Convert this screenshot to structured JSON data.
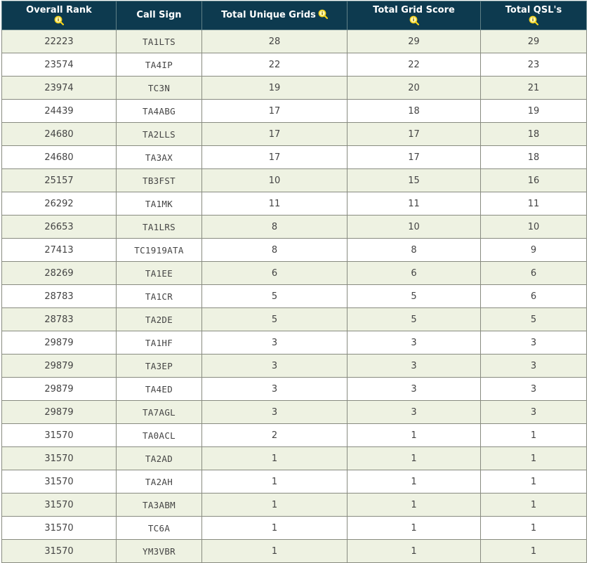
{
  "headers": [
    {
      "label": "Overall Rank",
      "icon": "magnifier-info-icon",
      "icon_below": true
    },
    {
      "label": "Call Sign",
      "icon": null,
      "icon_below": false
    },
    {
      "label": "Total Unique Grids",
      "icon": "magnifier-info-icon",
      "icon_below": false
    },
    {
      "label": "Total Grid Score",
      "icon": "magnifier-info-icon",
      "icon_below": true
    },
    {
      "label": "Total QSL's",
      "icon": "magnifier-info-icon",
      "icon_below": true
    }
  ],
  "rows": [
    [
      "22223",
      "TA1LTS",
      "28",
      "29",
      "29"
    ],
    [
      "23574",
      "TA4IP",
      "22",
      "22",
      "23"
    ],
    [
      "23974",
      "TC3N",
      "19",
      "20",
      "21"
    ],
    [
      "24439",
      "TA4ABG",
      "17",
      "18",
      "19"
    ],
    [
      "24680",
      "TA2LLS",
      "17",
      "17",
      "18"
    ],
    [
      "24680",
      "TA3AX",
      "17",
      "17",
      "18"
    ],
    [
      "25157",
      "TB3FST",
      "10",
      "15",
      "16"
    ],
    [
      "26292",
      "TA1MK",
      "11",
      "11",
      "11"
    ],
    [
      "26653",
      "TA1LRS",
      "8",
      "10",
      "10"
    ],
    [
      "27413",
      "TC1919ATA",
      "8",
      "8",
      "9"
    ],
    [
      "28269",
      "TA1EE",
      "6",
      "6",
      "6"
    ],
    [
      "28783",
      "TA1CR",
      "5",
      "5",
      "6"
    ],
    [
      "28783",
      "TA2DE",
      "5",
      "5",
      "5"
    ],
    [
      "29879",
      "TA1HF",
      "3",
      "3",
      "3"
    ],
    [
      "29879",
      "TA3EP",
      "3",
      "3",
      "3"
    ],
    [
      "29879",
      "TA4ED",
      "3",
      "3",
      "3"
    ],
    [
      "29879",
      "TA7AGL",
      "3",
      "3",
      "3"
    ],
    [
      "31570",
      "TA0ACL",
      "2",
      "1",
      "1"
    ],
    [
      "31570",
      "TA2AD",
      "1",
      "1",
      "1"
    ],
    [
      "31570",
      "TA2AH",
      "1",
      "1",
      "1"
    ],
    [
      "31570",
      "TA3ABM",
      "1",
      "1",
      "1"
    ],
    [
      "31570",
      "TC6A",
      "1",
      "1",
      "1"
    ],
    [
      "31570",
      "YM3VBR",
      "1",
      "1",
      "1"
    ]
  ],
  "colors": {
    "header_bg": "#0d3a4f",
    "row_alt": "#eef2e2",
    "row": "#ffffff",
    "icon": "#f3d21b"
  }
}
